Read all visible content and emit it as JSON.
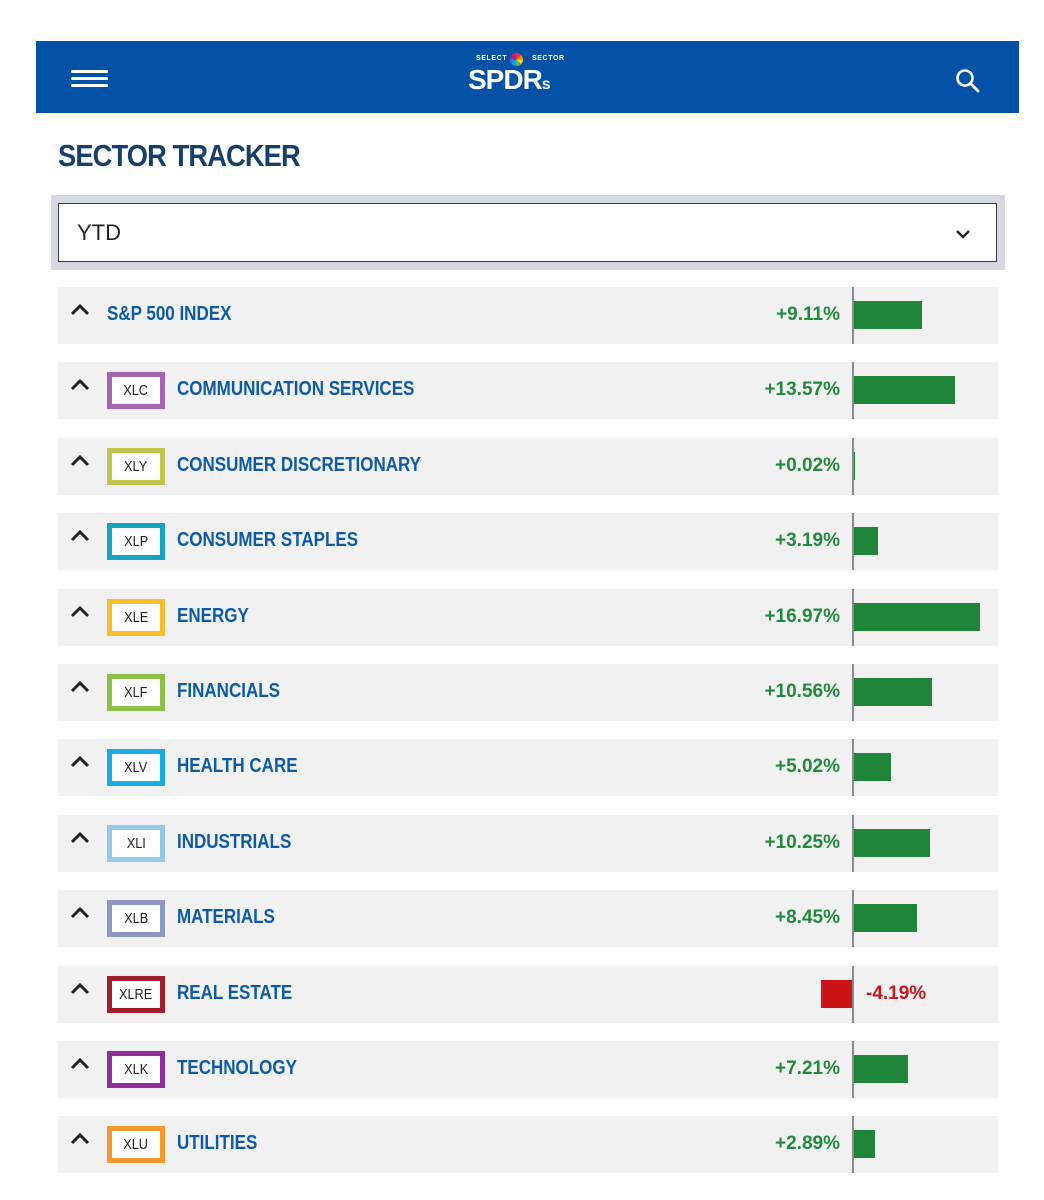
{
  "header": {
    "menu_icon": "hamburger-menu-icon",
    "logo": {
      "top_left": "SELECT",
      "top_right": "SECTOR",
      "main": "SPDR",
      "suffix": "s"
    },
    "search_icon": "search-icon",
    "background_color": "#0152a6"
  },
  "page": {
    "title": "SECTOR TRACKER"
  },
  "period_select": {
    "value": "YTD",
    "icon": "chevron-down-icon"
  },
  "colors": {
    "positive": "#218a3c",
    "negative": "#c9161a",
    "bar_positive": "#1e8539",
    "bar_negative": "#cc1417"
  },
  "rows": [
    {
      "ticker": "",
      "name": "S&P 500 INDEX",
      "change": "+9.11%",
      "value": 9.11,
      "ticker_color": ""
    },
    {
      "ticker": "XLC",
      "name": "COMMUNICATION SERVICES",
      "change": "+13.57%",
      "value": 13.57,
      "ticker_color": "#a564b4"
    },
    {
      "ticker": "XLY",
      "name": "CONSUMER DISCRETIONARY",
      "change": "+0.02%",
      "value": 0.02,
      "ticker_color": "#c1c54b"
    },
    {
      "ticker": "XLP",
      "name": "CONSUMER STAPLES",
      "change": "+3.19%",
      "value": 3.19,
      "ticker_color": "#17a5bd"
    },
    {
      "ticker": "XLE",
      "name": "ENERGY",
      "change": "+16.97%",
      "value": 16.97,
      "ticker_color": "#fbbd2a"
    },
    {
      "ticker": "XLF",
      "name": "FINANCIALS",
      "change": "+10.56%",
      "value": 10.56,
      "ticker_color": "#8cc146"
    },
    {
      "ticker": "XLV",
      "name": "HEALTH CARE",
      "change": "+5.02%",
      "value": 5.02,
      "ticker_color": "#18ade5"
    },
    {
      "ticker": "XLI",
      "name": "INDUSTRIALS",
      "change": "+10.25%",
      "value": 10.25,
      "ticker_color": "#94c9ea"
    },
    {
      "ticker": "XLB",
      "name": "MATERIALS",
      "change": "+8.45%",
      "value": 8.45,
      "ticker_color": "#8c96c5"
    },
    {
      "ticker": "XLRE",
      "name": "REAL ESTATE",
      "change": "-4.19%",
      "value": -4.19,
      "ticker_color": "#a31b2f"
    },
    {
      "ticker": "XLK",
      "name": "TECHNOLOGY",
      "change": "+7.21%",
      "value": 7.21,
      "ticker_color": "#8e2c98"
    },
    {
      "ticker": "XLU",
      "name": "UTILITIES",
      "change": "+2.89%",
      "value": 2.89,
      "ticker_color": "#f7982a"
    }
  ]
}
